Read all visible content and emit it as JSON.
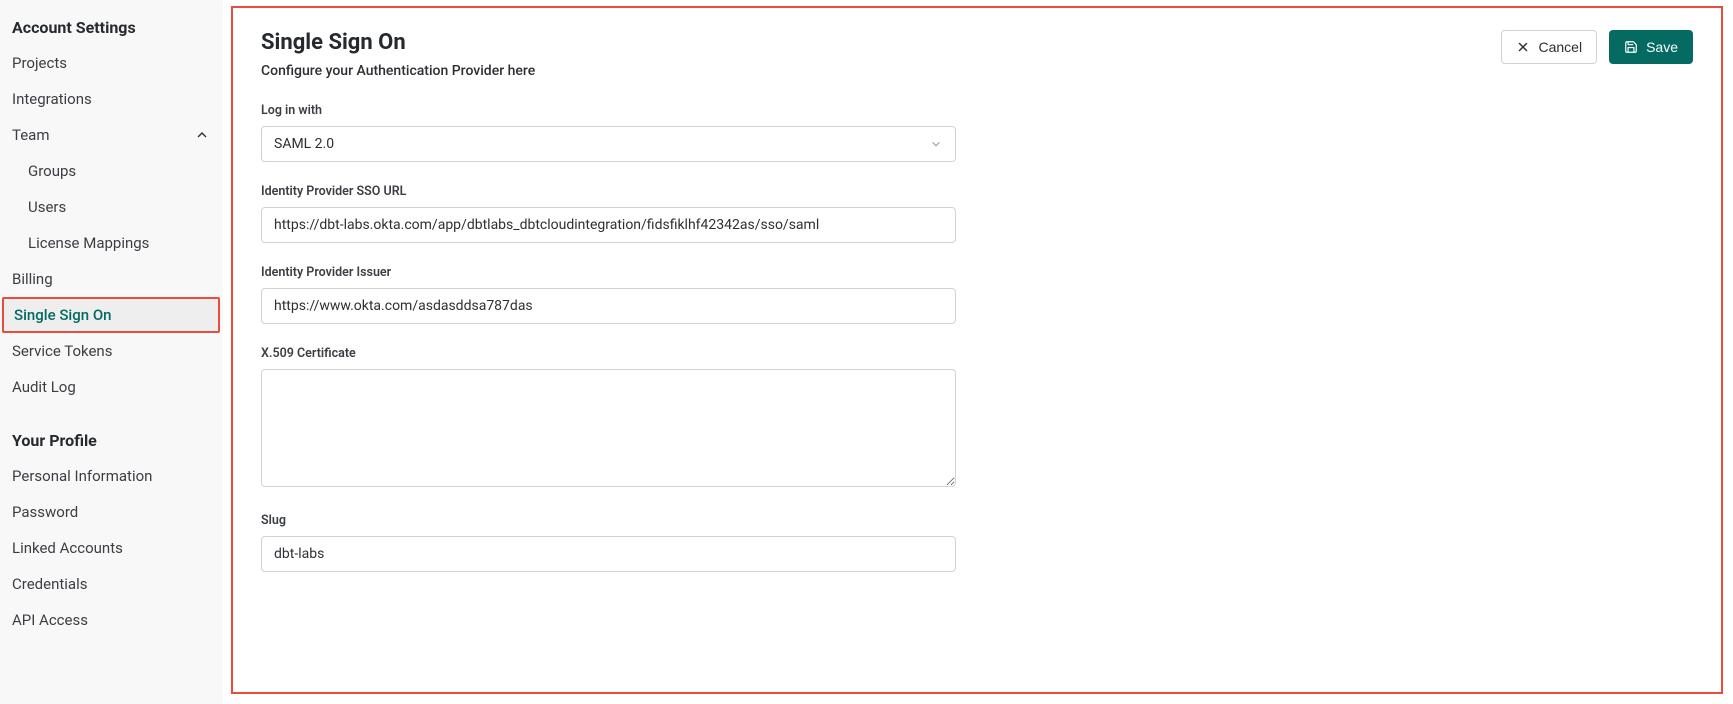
{
  "sidebar": {
    "section1_title": "Account Settings",
    "projects": "Projects",
    "integrations": "Integrations",
    "team": "Team",
    "team_groups": "Groups",
    "team_users": "Users",
    "team_license": "License Mappings",
    "billing": "Billing",
    "sso": "Single Sign On",
    "service_tokens": "Service Tokens",
    "audit_log": "Audit Log",
    "section2_title": "Your Profile",
    "personal_info": "Personal Information",
    "password": "Password",
    "linked_accounts": "Linked Accounts",
    "credentials": "Credentials",
    "api_access": "API Access"
  },
  "header": {
    "title": "Single Sign On",
    "subtitle": "Configure your Authentication Provider here",
    "cancel": "Cancel",
    "save": "Save"
  },
  "form": {
    "login_with_label": "Log in with",
    "login_with_value": "SAML 2.0",
    "sso_url_label": "Identity Provider SSO URL",
    "sso_url_value": "https://dbt-labs.okta.com/app/dbtlabs_dbtcloudintegration/fidsfiklhf42342as/sso/saml",
    "issuer_label": "Identity Provider Issuer",
    "issuer_value": "https://www.okta.com/asdasddsa787das",
    "cert_label": "X.509 Certificate",
    "cert_value": "",
    "slug_label": "Slug",
    "slug_value": "dbt-labs"
  }
}
